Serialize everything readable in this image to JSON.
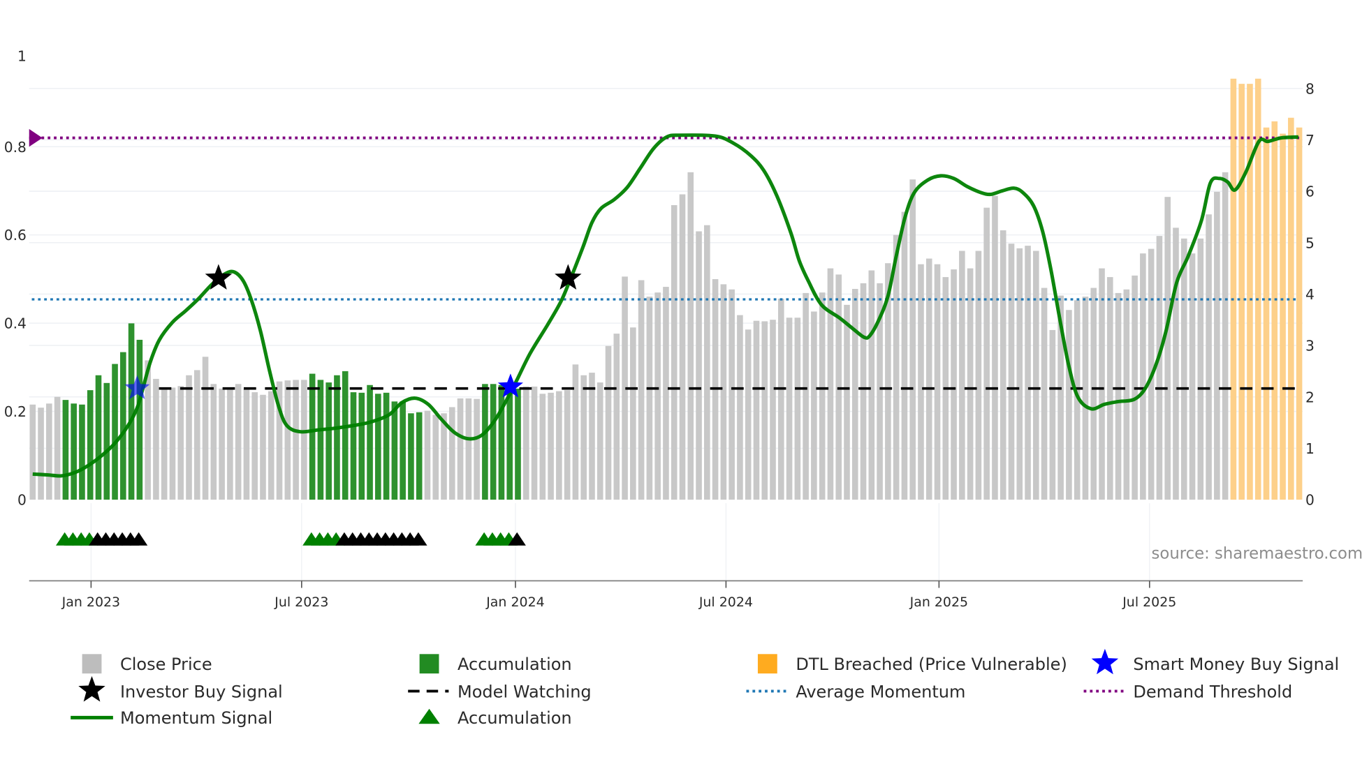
{
  "chart_data": {
    "type": "bar",
    "title": "",
    "xlabel": "",
    "ylabel_left": "",
    "ylabel_right": "",
    "left_axis": {
      "range": [
        0,
        1
      ],
      "ticks": [
        "0",
        "0.2",
        "0.4",
        "0.6",
        "0.8",
        "1"
      ],
      "tick_values": [
        0,
        0.2,
        0.4,
        0.6,
        0.8,
        1
      ]
    },
    "right_axis": {
      "range": [
        0,
        8
      ],
      "ticks": [
        "0",
        "1",
        "2",
        "3",
        "4",
        "5",
        "6",
        "7",
        "8"
      ],
      "tick_values": [
        0,
        1,
        2,
        3,
        4,
        5,
        6,
        7,
        8
      ]
    },
    "x_ticks": [
      {
        "label": "Jan 2023",
        "bar_index": 7.1
      },
      {
        "label": "Jul 2023",
        "bar_index": 32.7
      },
      {
        "label": "Jan 2024",
        "bar_index": 58.7
      },
      {
        "label": "Jul 2024",
        "bar_index": 84.3
      },
      {
        "label": "Jan 2025",
        "bar_index": 110.2
      },
      {
        "label": "Jul 2025",
        "bar_index": 135.8
      }
    ],
    "close_price": [
      1.85,
      1.79,
      1.87,
      2.0,
      1.94,
      1.87,
      1.85,
      2.13,
      2.42,
      2.27,
      2.64,
      2.87,
      3.43,
      3.11,
      2.71,
      2.35,
      2.16,
      2.18,
      2.21,
      2.42,
      2.52,
      2.78,
      2.25,
      2.16,
      2.16,
      2.25,
      2.16,
      2.09,
      2.04,
      2.11,
      2.3,
      2.32,
      2.33,
      2.33,
      2.45,
      2.33,
      2.28,
      2.42,
      2.5,
      2.09,
      2.08,
      2.23,
      2.06,
      2.08,
      1.91,
      1.91,
      1.68,
      1.7,
      1.73,
      1.65,
      1.68,
      1.8,
      1.97,
      1.97,
      1.96,
      2.25,
      2.25,
      2.23,
      2.16,
      2.16,
      2.2,
      2.2,
      2.06,
      2.08,
      2.11,
      2.13,
      2.63,
      2.42,
      2.47,
      2.28,
      2.99,
      3.23,
      4.34,
      3.35,
      4.27,
      3.95,
      4.03,
      4.14,
      5.73,
      5.94,
      6.37,
      5.22,
      5.34,
      4.29,
      4.19,
      4.09,
      3.59,
      3.31,
      3.48,
      3.47,
      3.5,
      3.91,
      3.54,
      3.54,
      4.02,
      3.66,
      4.03,
      4.5,
      4.38,
      3.79,
      4.1,
      4.21,
      4.46,
      4.21,
      4.6,
      5.15,
      5.6,
      6.23,
      4.58,
      4.69,
      4.58,
      4.33,
      4.48,
      4.84,
      4.5,
      4.84,
      5.68,
      5.91,
      5.24,
      4.98,
      4.89,
      4.94,
      4.84,
      4.12,
      3.3,
      3.97,
      3.69,
      3.88,
      3.95,
      4.12,
      4.5,
      4.33,
      4.02,
      4.09,
      4.36,
      4.79,
      4.88,
      5.13,
      5.89,
      5.29,
      5.08,
      4.79,
      5.08,
      5.55,
      5.99,
      6.37,
      8.19,
      8.09,
      8.09,
      8.19,
      7.24,
      7.36,
      7.12,
      7.43,
      7.24
    ],
    "accumulation_bar_ranges": [
      [
        5,
        14
      ],
      [
        35,
        48
      ],
      [
        56,
        60
      ]
    ],
    "dtl_breached_bar_ranges": [
      [
        147,
        155
      ]
    ],
    "momentum_signal": [
      [
        0,
        0.058
      ],
      [
        1.9,
        0.056
      ],
      [
        3.5,
        0.054
      ],
      [
        5.2,
        0.062
      ],
      [
        6.8,
        0.078
      ],
      [
        8.4,
        0.1
      ],
      [
        10,
        0.128
      ],
      [
        11.6,
        0.168
      ],
      [
        12.7,
        0.208
      ],
      [
        13.4,
        0.252
      ],
      [
        14.3,
        0.312
      ],
      [
        15.4,
        0.362
      ],
      [
        17,
        0.402
      ],
      [
        18.6,
        0.428
      ],
      [
        20.2,
        0.456
      ],
      [
        21.8,
        0.488
      ],
      [
        23.4,
        0.512
      ],
      [
        24.5,
        0.516
      ],
      [
        25.6,
        0.496
      ],
      [
        26.6,
        0.452
      ],
      [
        27.7,
        0.382
      ],
      [
        28.8,
        0.292
      ],
      [
        29.9,
        0.212
      ],
      [
        30.9,
        0.168
      ],
      [
        32.5,
        0.154
      ],
      [
        34.7,
        0.158
      ],
      [
        36.8,
        0.162
      ],
      [
        39,
        0.168
      ],
      [
        41.1,
        0.176
      ],
      [
        43.3,
        0.192
      ],
      [
        44.9,
        0.22
      ],
      [
        46.5,
        0.23
      ],
      [
        48.1,
        0.216
      ],
      [
        49.7,
        0.182
      ],
      [
        51.3,
        0.152
      ],
      [
        53,
        0.138
      ],
      [
        54.6,
        0.146
      ],
      [
        56.2,
        0.18
      ],
      [
        57.8,
        0.232
      ],
      [
        58.9,
        0.272
      ],
      [
        60.5,
        0.332
      ],
      [
        62.6,
        0.396
      ],
      [
        64.2,
        0.448
      ],
      [
        65.3,
        0.496
      ],
      [
        66.9,
        0.572
      ],
      [
        68,
        0.628
      ],
      [
        69.1,
        0.66
      ],
      [
        70.7,
        0.68
      ],
      [
        72.3,
        0.708
      ],
      [
        73.9,
        0.752
      ],
      [
        75.5,
        0.796
      ],
      [
        77.1,
        0.822
      ],
      [
        78.7,
        0.826
      ],
      [
        83,
        0.824
      ],
      [
        85.2,
        0.808
      ],
      [
        87.3,
        0.78
      ],
      [
        88.9,
        0.746
      ],
      [
        90.5,
        0.688
      ],
      [
        92.2,
        0.604
      ],
      [
        93.2,
        0.542
      ],
      [
        94.3,
        0.496
      ],
      [
        95.9,
        0.442
      ],
      [
        98.1,
        0.412
      ],
      [
        99.7,
        0.388
      ],
      [
        101.1,
        0.368
      ],
      [
        101.8,
        0.372
      ],
      [
        102.9,
        0.408
      ],
      [
        104,
        0.462
      ],
      [
        105,
        0.552
      ],
      [
        106.1,
        0.642
      ],
      [
        107.2,
        0.696
      ],
      [
        108.8,
        0.724
      ],
      [
        110.4,
        0.734
      ],
      [
        112,
        0.728
      ],
      [
        113.6,
        0.71
      ],
      [
        115.3,
        0.696
      ],
      [
        116.5,
        0.692
      ],
      [
        117.9,
        0.7
      ],
      [
        119.3,
        0.706
      ],
      [
        120.4,
        0.696
      ],
      [
        121.7,
        0.666
      ],
      [
        122.8,
        0.608
      ],
      [
        123.8,
        0.522
      ],
      [
        124.9,
        0.408
      ],
      [
        126,
        0.302
      ],
      [
        127.1,
        0.232
      ],
      [
        128.7,
        0.206
      ],
      [
        130.3,
        0.216
      ],
      [
        131.9,
        0.222
      ],
      [
        134,
        0.228
      ],
      [
        135.4,
        0.256
      ],
      [
        136.7,
        0.312
      ],
      [
        137.8,
        0.382
      ],
      [
        139.1,
        0.492
      ],
      [
        140.5,
        0.552
      ],
      [
        142.1,
        0.632
      ],
      [
        143.2,
        0.718
      ],
      [
        144.3,
        0.728
      ],
      [
        145.3,
        0.72
      ],
      [
        146.2,
        0.702
      ],
      [
        147.5,
        0.742
      ],
      [
        149.1,
        0.812
      ],
      [
        150.2,
        0.812
      ],
      [
        151.8,
        0.82
      ],
      [
        153.9,
        0.822
      ]
    ],
    "demand_threshold": 0.82,
    "average_momentum": 0.454,
    "model_watching": 0.252,
    "investor_buy_signals": [
      [
        22.6,
        0.502
      ],
      [
        65.1,
        0.502
      ]
    ],
    "smart_money_buy_signals": [
      [
        12.7,
        0.252
      ],
      [
        58.1,
        0.256
      ]
    ],
    "accumulation_markers": [
      {
        "start_bar": 5,
        "green": 4,
        "black": 6
      },
      {
        "start_bar": 35,
        "green": 4,
        "black": 10
      },
      {
        "start_bar": 56,
        "green": 4,
        "black": 1
      }
    ],
    "legend": {
      "placement": "bottom",
      "items": [
        {
          "label": "Close Price",
          "symbol": "square",
          "color": "#bdbdbd"
        },
        {
          "label": "Accumulation",
          "symbol": "square",
          "color": "#228b22"
        },
        {
          "label": "DTL Breached (Price Vulnerable)",
          "symbol": "square",
          "color": "#ffab1f"
        },
        {
          "label": "Smart Money Buy Signal",
          "symbol": "star",
          "color": "#0000ff"
        },
        {
          "label": "Investor Buy Signal",
          "symbol": "star",
          "color": "#000000"
        },
        {
          "label": "Model Watching",
          "symbol": "dash",
          "color": "#000000"
        },
        {
          "label": "Average Momentum",
          "symbol": "dot",
          "color": "#1f77b4"
        },
        {
          "label": "Demand Threshold",
          "symbol": "dot",
          "color": "#800080"
        },
        {
          "label": "Momentum Signal",
          "symbol": "line",
          "color": "#008000"
        },
        {
          "label": "Accumulation",
          "symbol": "triangle",
          "color": "#008000"
        }
      ]
    },
    "colors": {
      "close": "#c8c8c8",
      "accumulation": "#2e922e",
      "dtl": "#fdd08a",
      "momentum": "#008000",
      "avg_momentum": "#1f77b4",
      "demand": "#800080",
      "grid": "#eef0f4"
    },
    "grid": true
  },
  "source": "source: sharemaestro.com"
}
